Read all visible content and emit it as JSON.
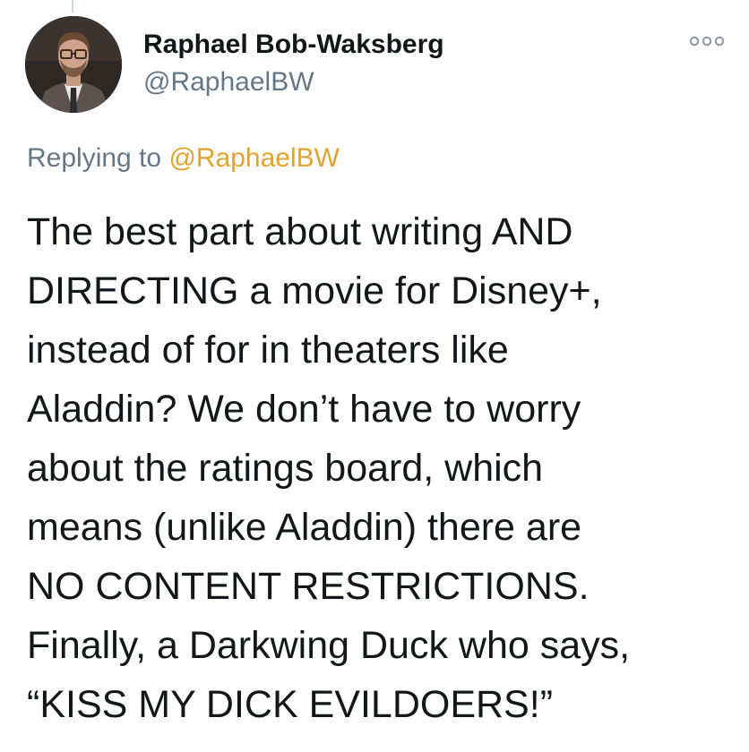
{
  "tweet": {
    "author_name": "Raphael Bob-Waksberg",
    "author_handle": "@RaphaelBW",
    "reply_prefix": "Replying to",
    "reply_mention": "@RaphaelBW",
    "text_lines": [
      "The best part about writing AND",
      "DIRECTING a movie for Disney+,",
      "instead of for in theaters like",
      "Aladdin? We don’t have to worry",
      "about the ratings board, which",
      "means (unlike Aladdin) there are",
      "NO CONTENT RESTRICTIONS.",
      "Finally, a Darkwing Duck who says,",
      "“KISS MY DICK EVILDOERS!”"
    ]
  },
  "icons": {
    "more": "more-options-icon",
    "avatar": "profile-photo"
  },
  "colors": {
    "text": "#14171a",
    "secondary": "#657786",
    "mention": "#e0a331"
  }
}
